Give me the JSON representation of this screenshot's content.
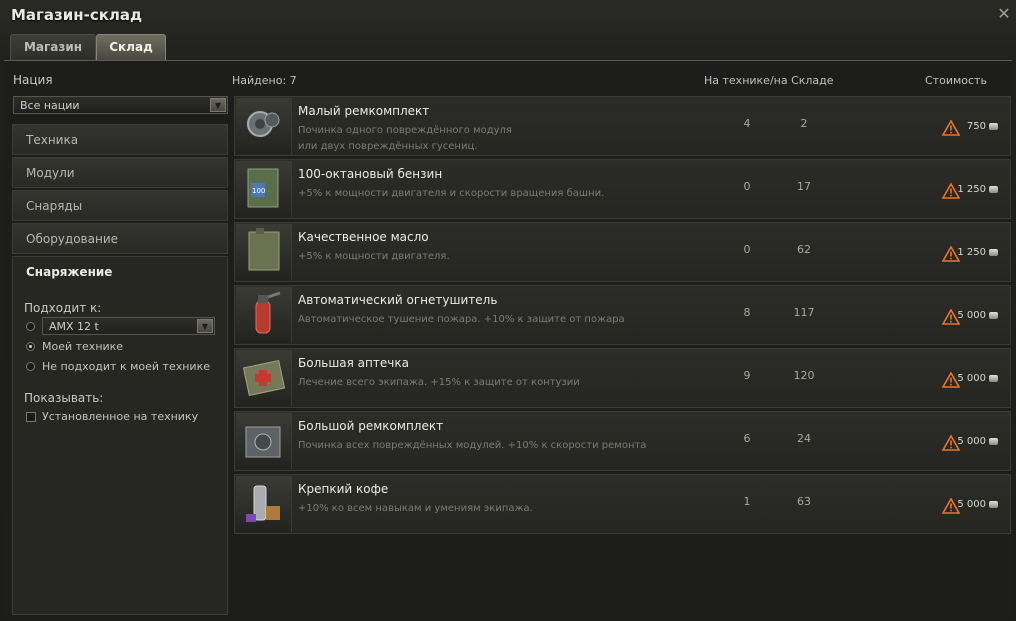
{
  "window": {
    "title": "Магазин-склад",
    "close_label": "✕"
  },
  "tabs": [
    {
      "label": "Магазин",
      "active": false
    },
    {
      "label": "Склад",
      "active": true
    }
  ],
  "filters": {
    "nation_label": "Нация",
    "nation_value": "Все нации",
    "categories": [
      "Техника",
      "Модули",
      "Снаряды",
      "Оборудование",
      "Снаряжение"
    ],
    "selected_category": "Снаряжение",
    "fits_label": "Подходит к:",
    "vehicle_value": "AMX 12 t",
    "radio_options": [
      "Моей технике",
      "Не подходит к моей технике"
    ],
    "show_label": "Показывать:",
    "installed_label": "Установленное на технику"
  },
  "list": {
    "found_label": "Найдено: 7",
    "col_stock": "На технике/на Складе",
    "col_price": "Стоимость",
    "items": [
      {
        "name": "Малый ремкомплект",
        "desc1": "Починка одного повреждённого модуля",
        "desc2": "или двух повреждённых гусениц.",
        "on_vehicle": "4",
        "in_stock": "2",
        "price": "750",
        "icon": "small-repair-kit-icon"
      },
      {
        "name": "100-октановый бензин",
        "desc1": "+5% к мощности двигателя и скорости вращения башни.",
        "desc2": "",
        "on_vehicle": "0",
        "in_stock": "17",
        "price": "1 250",
        "icon": "gasoline-can-icon"
      },
      {
        "name": "Качественное масло",
        "desc1": "+5% к мощности двигателя.",
        "desc2": "",
        "on_vehicle": "0",
        "in_stock": "62",
        "price": "1 250",
        "icon": "oil-can-icon"
      },
      {
        "name": "Автоматический огнетушитель",
        "desc1": "Автоматическое тушение пожара. +10% к защите от пожара",
        "desc2": "",
        "on_vehicle": "8",
        "in_stock": "117",
        "price": "5 000",
        "icon": "fire-extinguisher-icon"
      },
      {
        "name": "Большая аптечка",
        "desc1": "Лечение всего экипажа. +15% к защите от контузии",
        "desc2": "",
        "on_vehicle": "9",
        "in_stock": "120",
        "price": "5 000",
        "icon": "medkit-icon"
      },
      {
        "name": "Большой ремкомплект",
        "desc1": "Починка всех повреждённых модулей. +10% к скорости ремонта",
        "desc2": "",
        "on_vehicle": "6",
        "in_stock": "24",
        "price": "5 000",
        "icon": "large-repair-kit-icon"
      },
      {
        "name": "Крепкий кофе",
        "desc1": "+10% ко всем навыкам и умениям экипажа.",
        "desc2": "",
        "on_vehicle": "1",
        "in_stock": "63",
        "price": "5 000",
        "icon": "coffee-icon"
      }
    ]
  },
  "colors": {
    "warning": "#e8762a",
    "accent": "#6e6e60"
  }
}
